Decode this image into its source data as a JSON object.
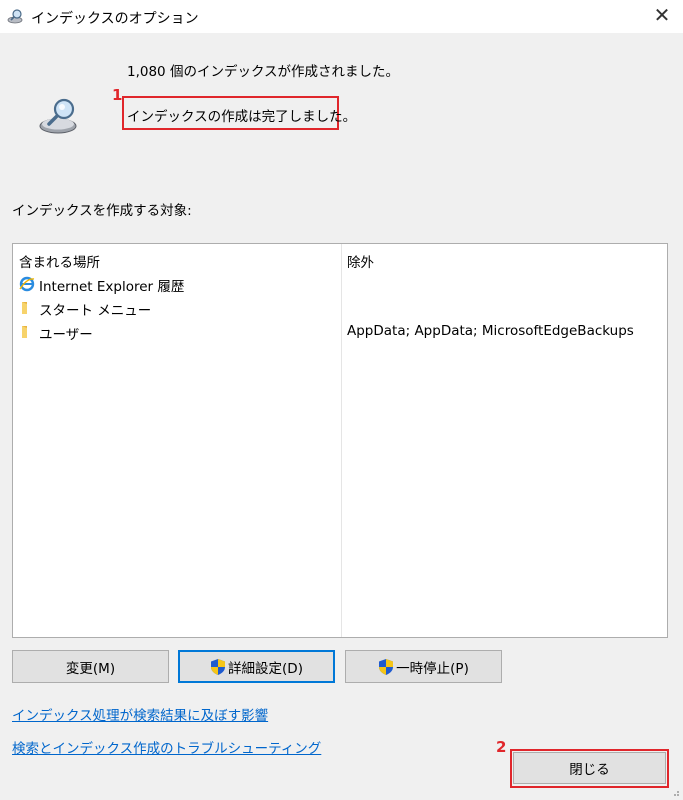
{
  "window": {
    "title": "インデックスのオプション",
    "close_icon": "close-icon"
  },
  "status": {
    "count_text": "1,080 個のインデックスが作成されました。",
    "complete_text": "インデックスの作成は完了しました。"
  },
  "section": {
    "label": "インデックスを作成する対象:"
  },
  "table": {
    "columns": {
      "location": "含まれる場所",
      "exclude": "除外"
    },
    "rows": [
      {
        "icon": "internet-explorer-icon",
        "location": "Internet Explorer 履歴",
        "exclude": ""
      },
      {
        "icon": "folder-icon",
        "location": "スタート メニュー",
        "exclude": ""
      },
      {
        "icon": "folder-icon",
        "location": "ユーザー",
        "exclude": "AppData; AppData; MicrosoftEdgeBackups"
      }
    ]
  },
  "buttons": {
    "modify": "変更(M)",
    "advanced": "詳細設定(D)",
    "pause": "一時停止(P)",
    "close": "閉じる"
  },
  "links": {
    "search_effect": "インデックス処理が検索結果に及ぼす影響",
    "troubleshoot": "検索とインデックス作成のトラブルシューティング"
  },
  "annotations": {
    "marker1": "1",
    "marker2": "2",
    "color": "#e0262b"
  },
  "colors": {
    "link": "#0066cc",
    "focus": "#0078d7",
    "shield_blue": "#1e5bd0",
    "shield_yellow": "#f5c518"
  }
}
